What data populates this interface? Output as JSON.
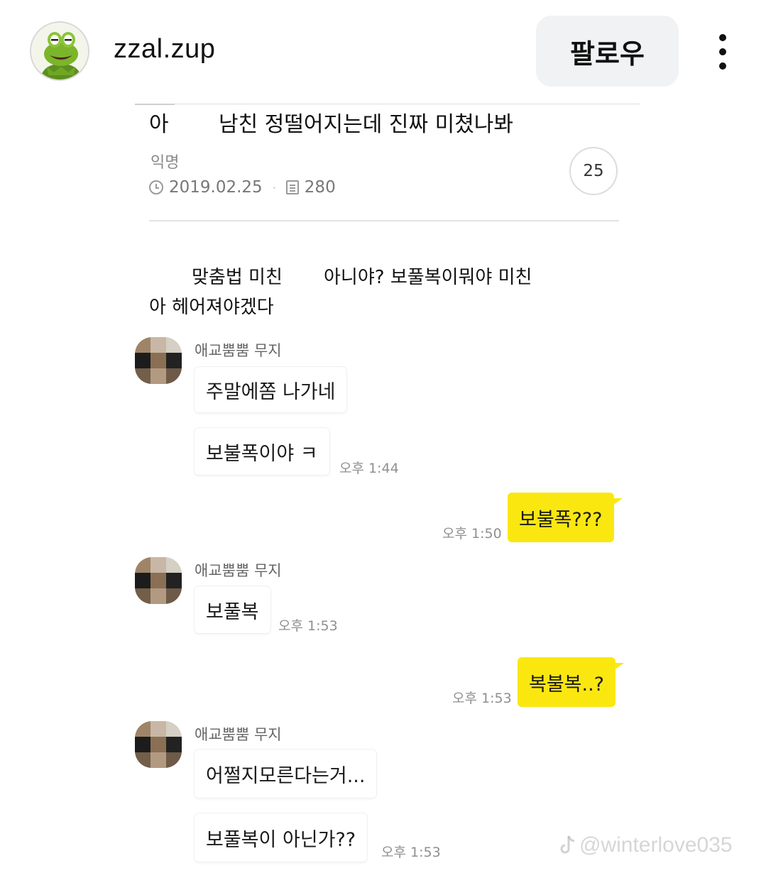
{
  "header": {
    "username": "zzal.zup",
    "follow_label": "팔로우"
  },
  "post": {
    "title_prefix": "아",
    "title": "남친 정떨어지는데 진짜 미쳤나봐",
    "author": "익명",
    "date": "2019.02.25",
    "views": "280",
    "comment_count": "25",
    "body_line1_a": "맞춤법 미친",
    "body_line1_b": "아니야? 보풀복이뭐야 미친",
    "body_line2": "아 헤어져야겠다"
  },
  "chat": {
    "sender_name": "애교뿜뿜 무지",
    "messages": [
      {
        "from": "other",
        "text": "주말에쫌 나가네",
        "time": ""
      },
      {
        "from": "other",
        "text": "보불폭이야 ㅋ",
        "time": "오후 1:44"
      },
      {
        "from": "me",
        "text": "보불폭???",
        "time": "오후 1:50"
      },
      {
        "from": "other",
        "text": "보풀복",
        "time": "오후 1:53"
      },
      {
        "from": "me",
        "text": "복불복..?",
        "time": "오후 1:53"
      },
      {
        "from": "other",
        "text": "어쩔지모른다는거...",
        "time": ""
      },
      {
        "from": "other",
        "text": "보풀복이 아닌가??",
        "time": "오후 1:53"
      }
    ]
  },
  "watermark": "@winterlove035",
  "colors": {
    "my_bubble": "#fbe710",
    "follow_bg": "#f0f2f4"
  },
  "icons": {
    "avatar": "kermit-frog-avatar",
    "more": "vertical-dots-icon",
    "clock": "clock-icon",
    "views": "document-icon",
    "watermark": "tiktok-icon"
  }
}
